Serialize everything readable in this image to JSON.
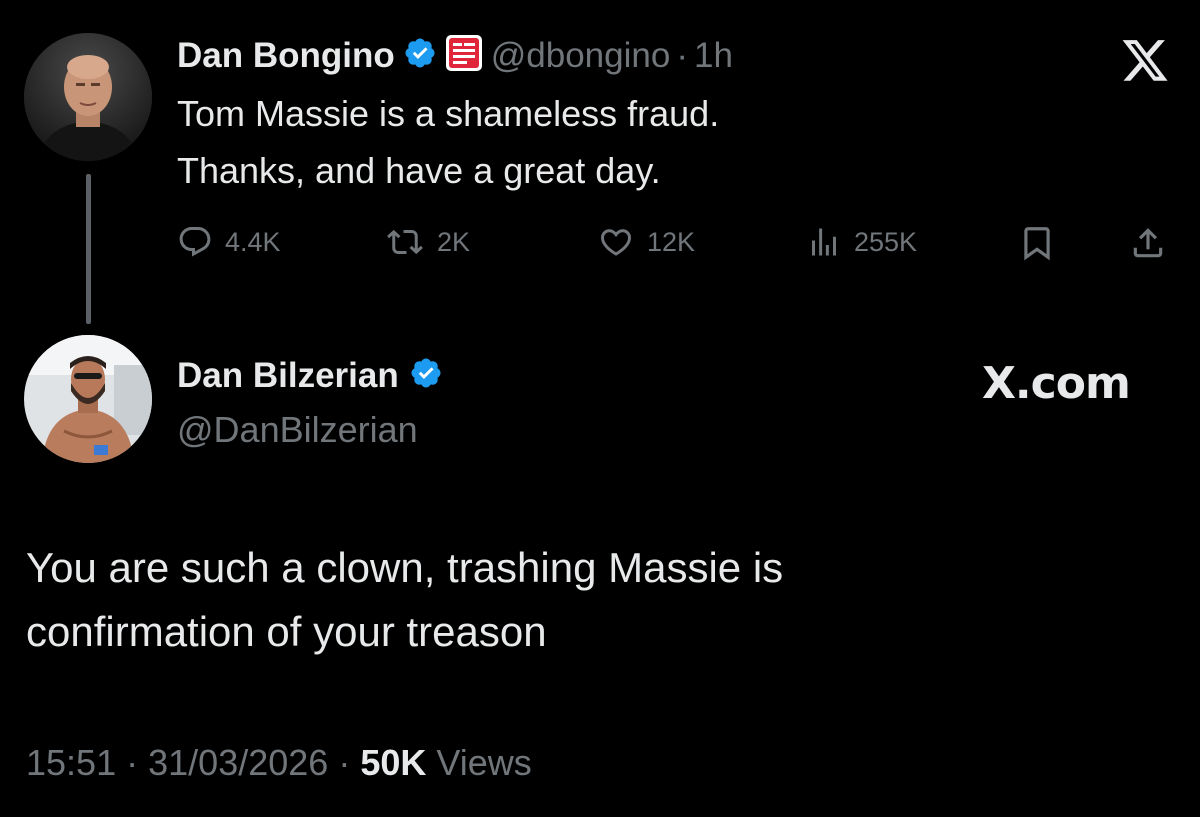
{
  "original_tweet": {
    "author_name": "Dan Bongino",
    "handle": "@dbongino",
    "separator": "·",
    "time_ago": "1h",
    "text_lines": [
      "Tom Massie is a shameless fraud.",
      "Thanks, and have a great day."
    ],
    "stats": {
      "replies": "4.4K",
      "reposts": "2K",
      "likes": "12K",
      "views": "255K"
    },
    "icons": [
      "verified-badge-icon",
      "news-affiliate-badge-icon",
      "x-logo-icon",
      "reply-icon",
      "repost-icon",
      "like-icon",
      "views-icon",
      "bookmark-icon",
      "share-icon"
    ]
  },
  "reply_tweet": {
    "author_name": "Dan Bilzerian",
    "handle": "@DanBilzerian",
    "brand": "X.com",
    "text": "You are such a clown, trashing Massie is confirmation of your treason",
    "time": "15:51",
    "separator": "·",
    "date": "31/03/2026",
    "views_count": "50K",
    "views_label": "Views"
  },
  "colors": {
    "background": "#000000",
    "text_primary": "#e7e9ea",
    "text_secondary": "#71767b",
    "verified_blue": "#1d9bf0",
    "affiliate_red": "#e0263b"
  }
}
